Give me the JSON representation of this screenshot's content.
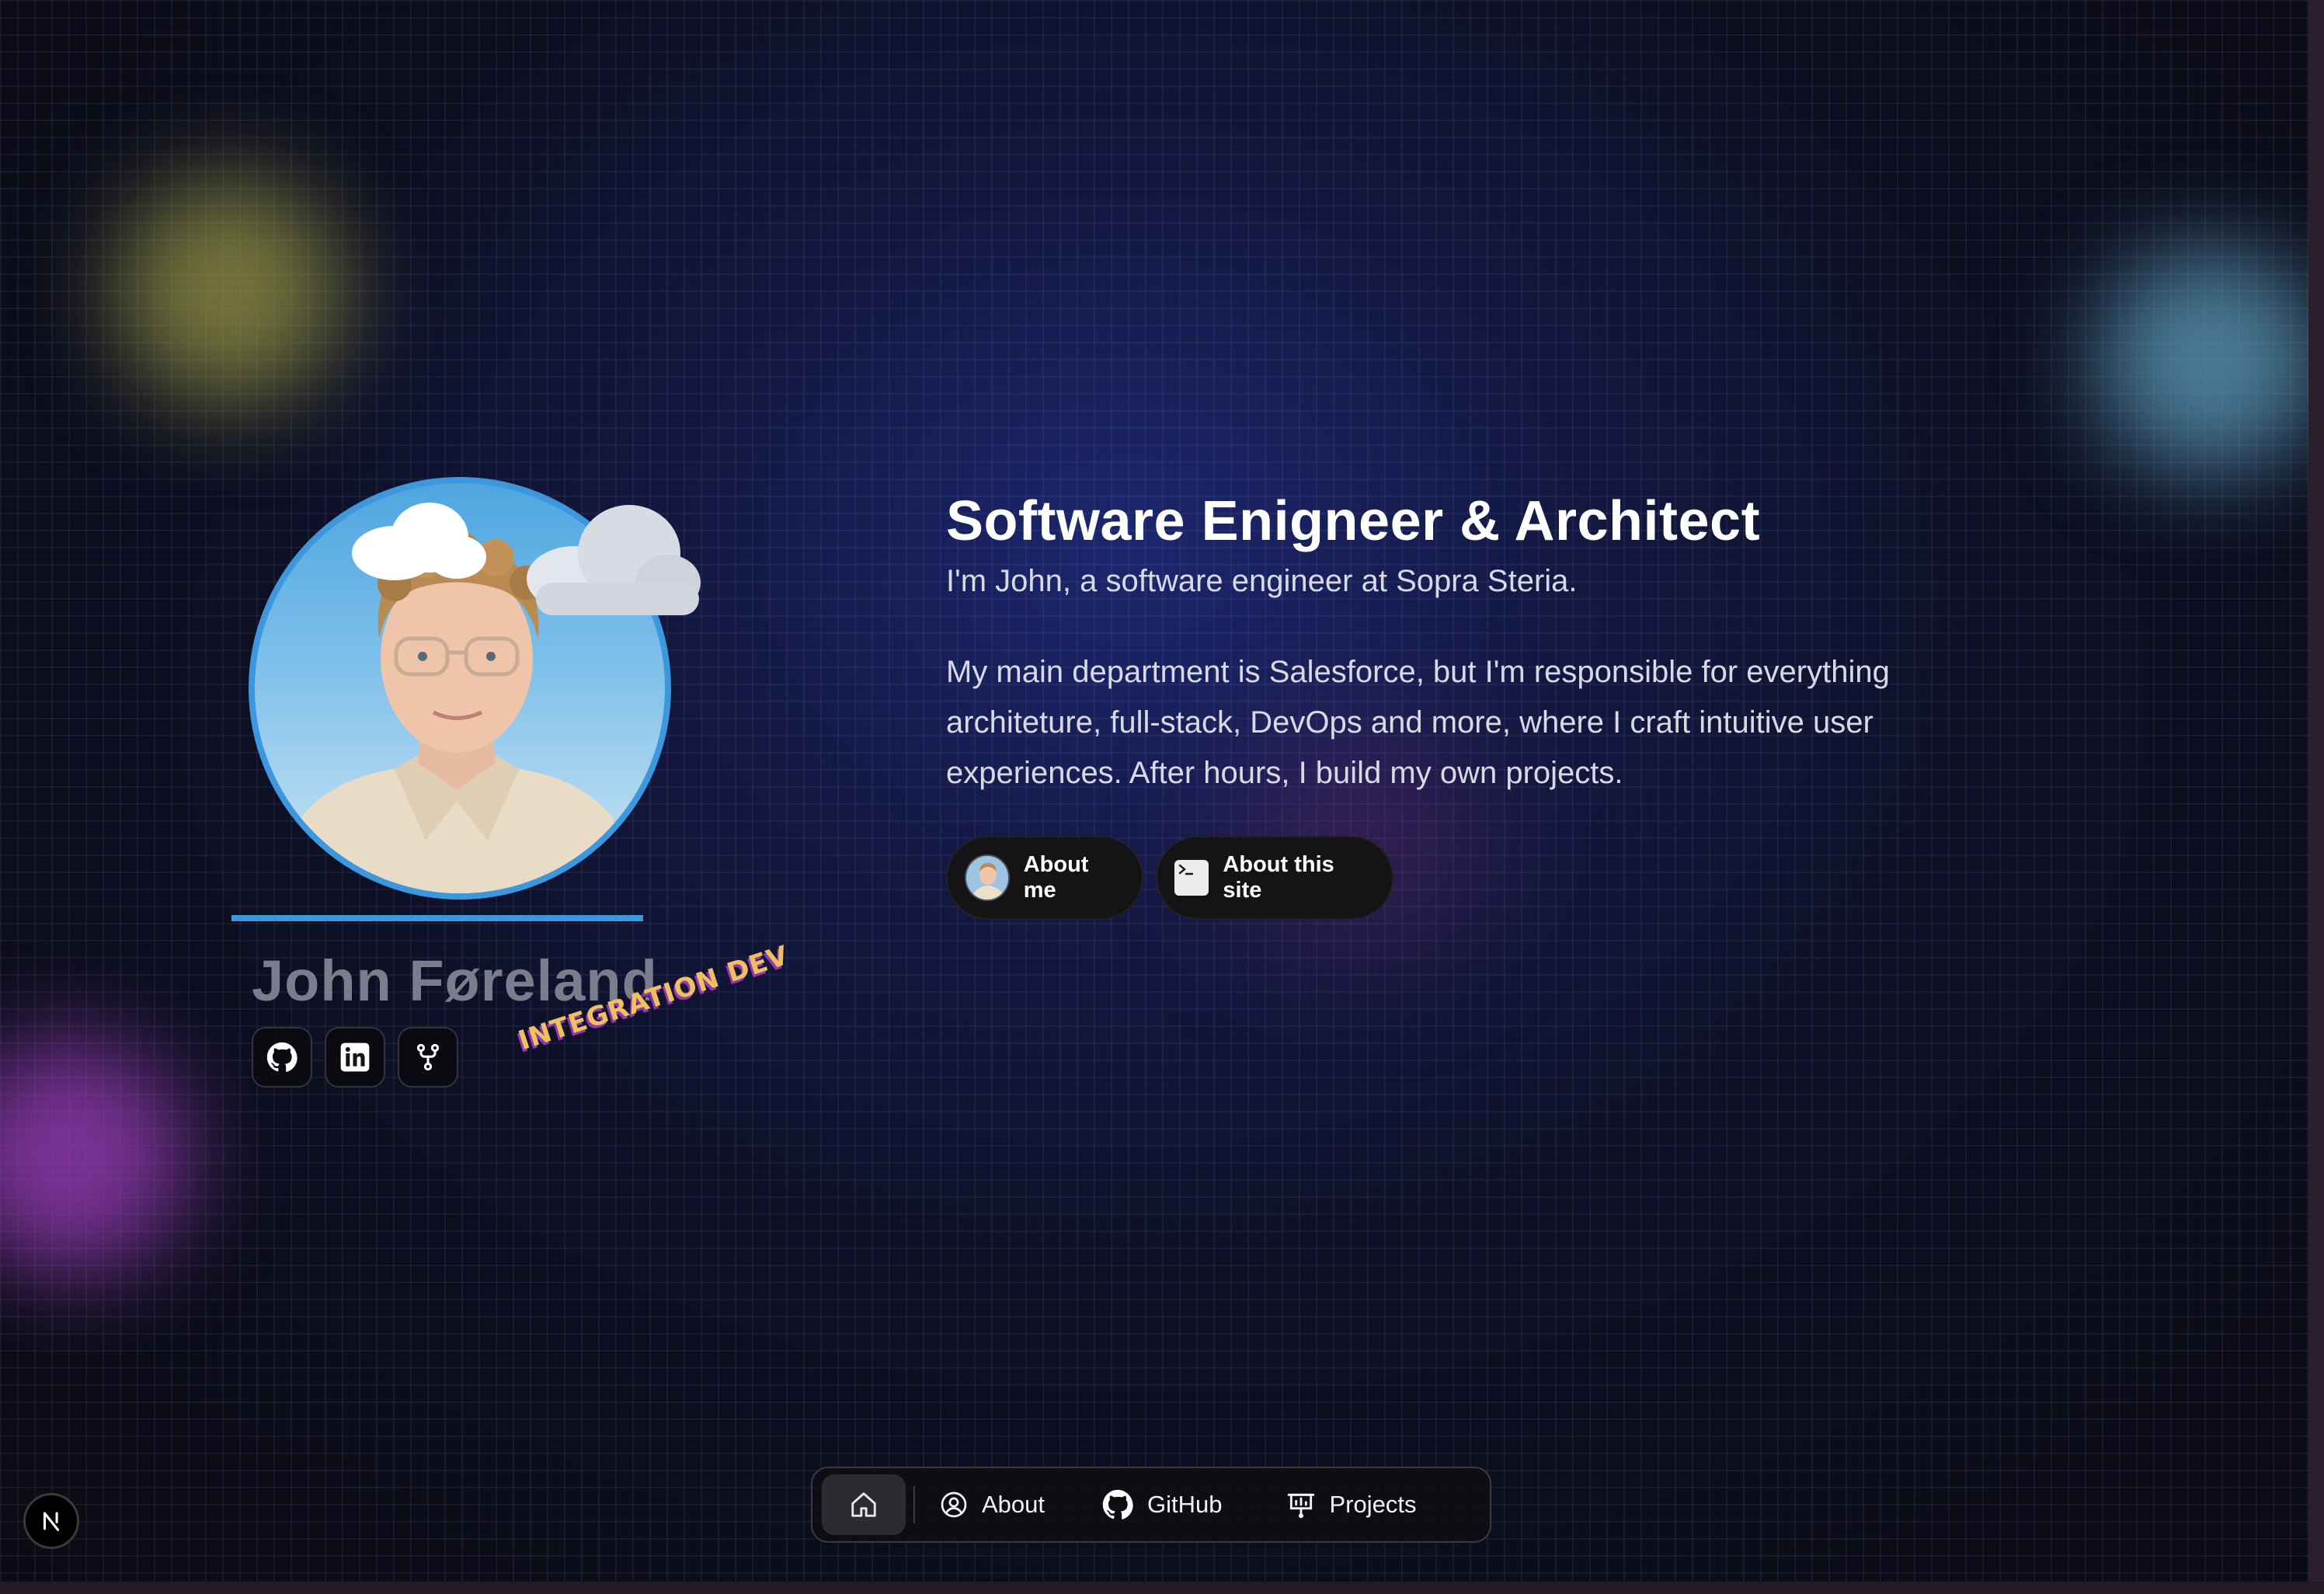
{
  "profile": {
    "name": "John Føreland",
    "badge": "INTEGRATION DEV",
    "socials": [
      {
        "icon": "github-icon"
      },
      {
        "icon": "linkedin-icon"
      },
      {
        "icon": "git-fork-icon"
      }
    ]
  },
  "hero": {
    "headline": "Software Enigneer & Architect",
    "intro": "I'm John, a software engineer at Sopra Steria.",
    "description": "My main department is Salesforce, but I'm responsible for everything architeture, full-stack, DevOps and more, where I craft intuitive user experiences. After hours, I build my own projects.",
    "buttons": {
      "about_me": "About me",
      "about_site": "About this site"
    }
  },
  "nav": {
    "home_icon": "home-icon",
    "items": [
      {
        "label": "About",
        "icon": "user-circle-icon"
      },
      {
        "label": "GitHub",
        "icon": "github-icon"
      },
      {
        "label": "Projects",
        "icon": "presentation-icon"
      }
    ]
  },
  "dev_indicator": {
    "label": "N"
  },
  "colors": {
    "accent_blue": "#3d97dc",
    "name_gray": "#7c7d8c",
    "badge_orange": "#f0c060",
    "badge_purple": "#8a3db0"
  }
}
